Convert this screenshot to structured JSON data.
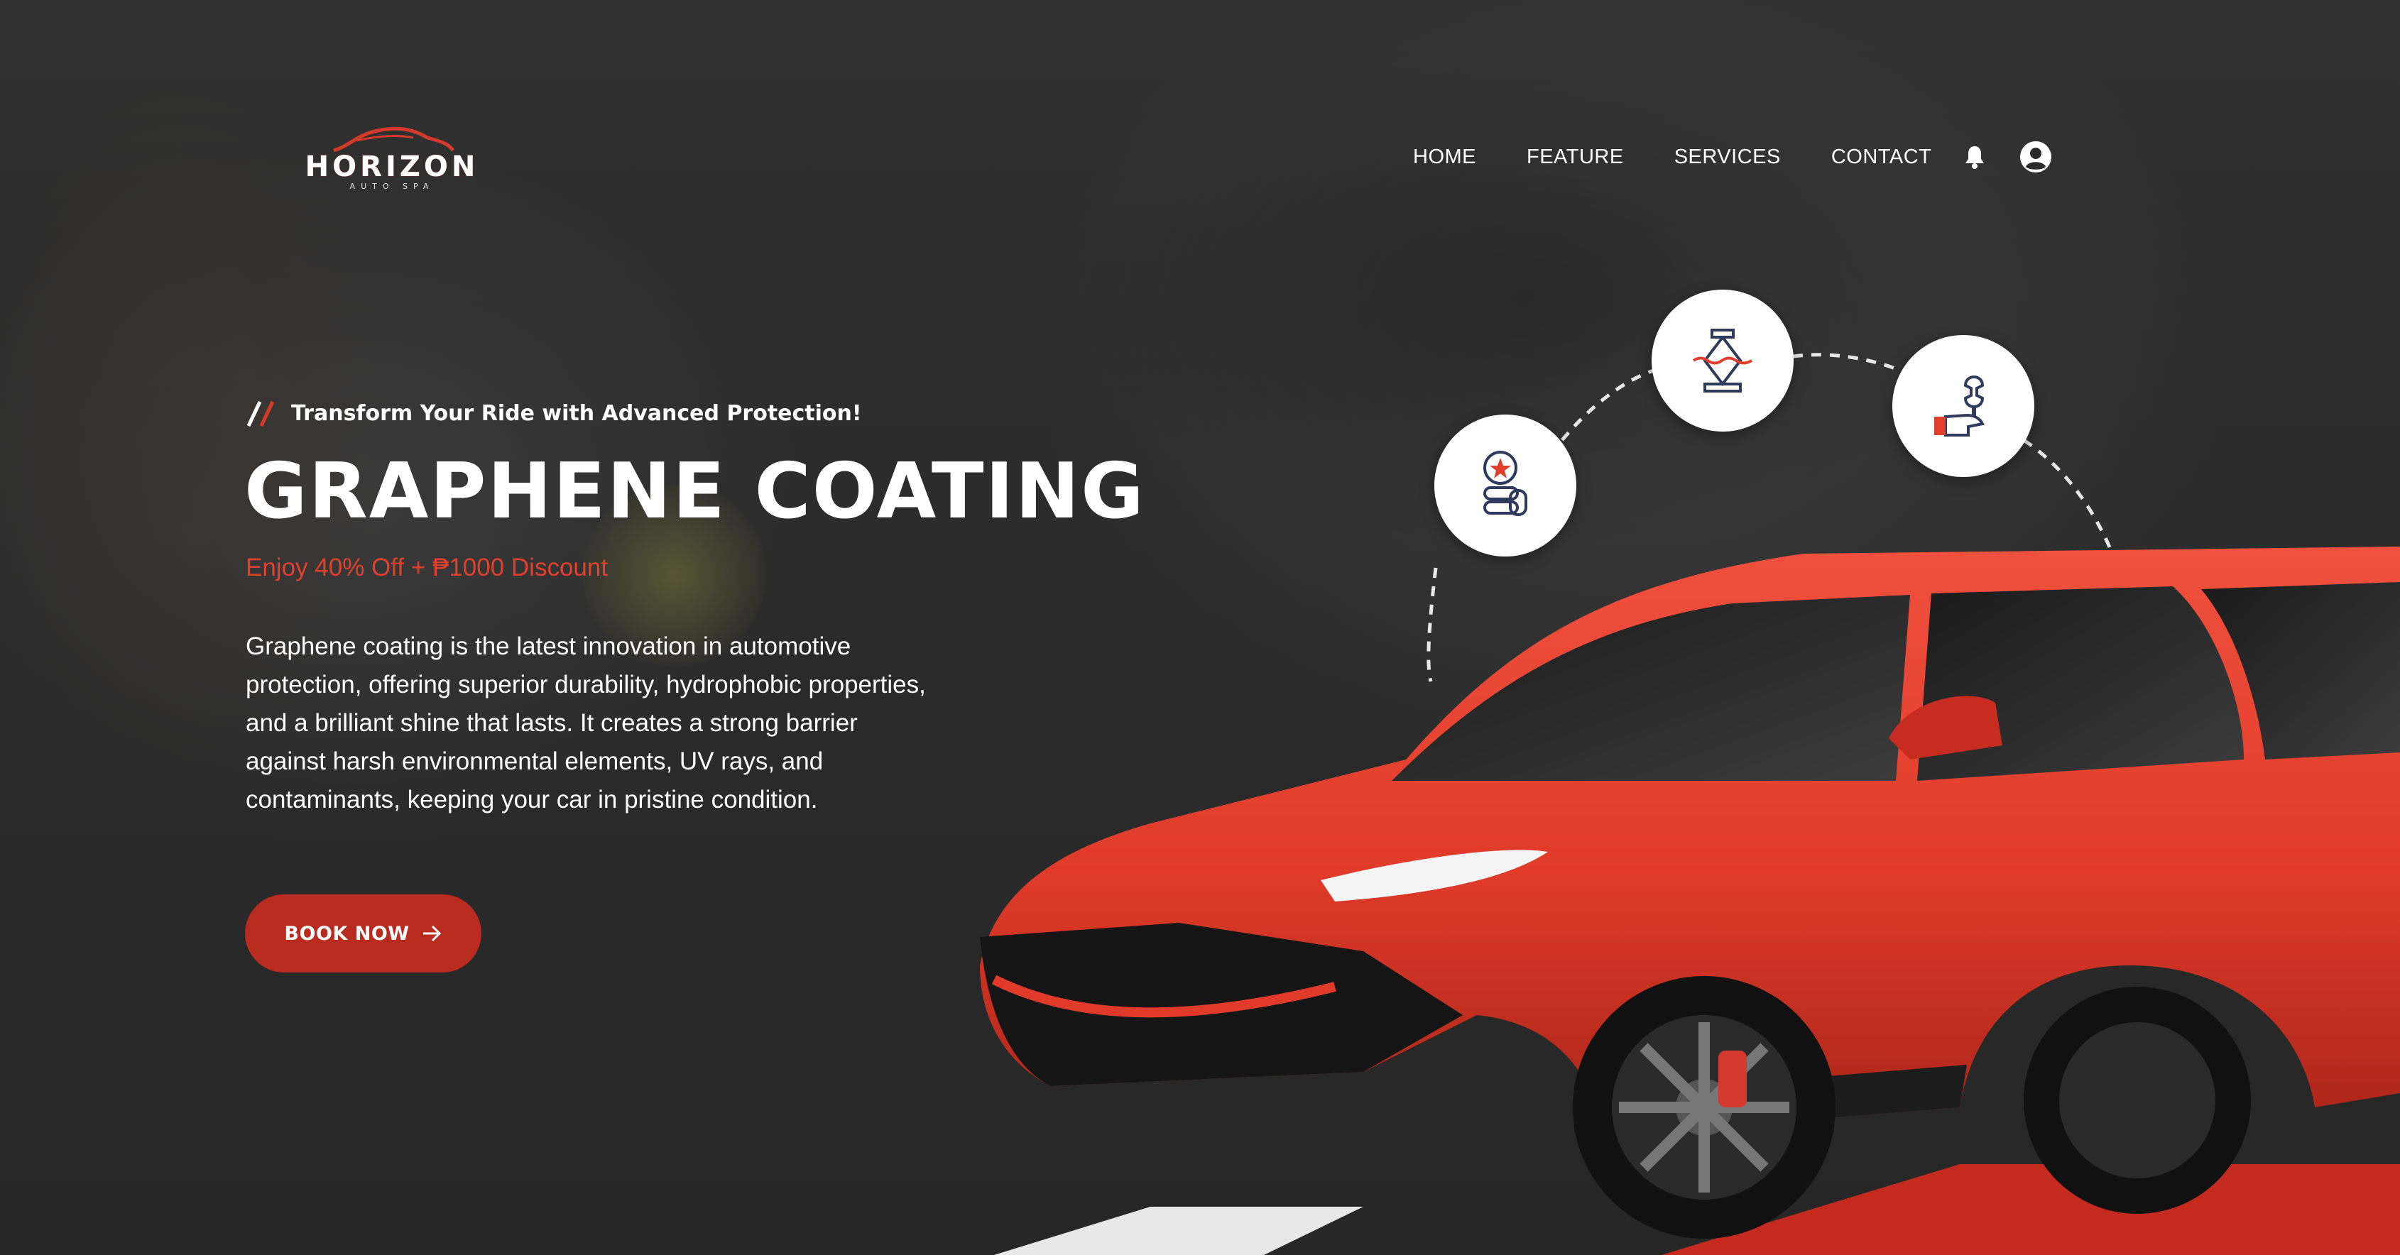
{
  "brand": {
    "name": "HORIZON",
    "tagline": "AUTO SPA"
  },
  "nav": {
    "items": [
      {
        "label": "HOME"
      },
      {
        "label": "FEATURE"
      },
      {
        "label": "SERVICES"
      },
      {
        "label": "CONTACT"
      }
    ],
    "icons": [
      "bell-icon",
      "user-account-icon"
    ]
  },
  "hero": {
    "eyebrow": "Transform Your Ride with Advanced Protection!",
    "title": "GRAPHENE COATING",
    "promo": "Enjoy 40% Off + ₱1000 Discount",
    "description": "Graphene coating is the latest innovation in automotive protection, offering superior durability, hydrophobic properties, and a brilliant shine that lasts. It creates a strong barrier against harsh environmental elements, UV rays, and contaminants, keeping your car in pristine condition.",
    "cta_label": "BOOK NOW"
  },
  "services": {
    "icons": [
      "tire-service-icon",
      "car-jack-icon",
      "repair-wrench-icon"
    ]
  },
  "colors": {
    "accent": "#b92a1f",
    "promo": "#e0402e",
    "background": "#2b2b2b",
    "text": "#ffffff",
    "icon_stroke": "#2f3a5c"
  }
}
